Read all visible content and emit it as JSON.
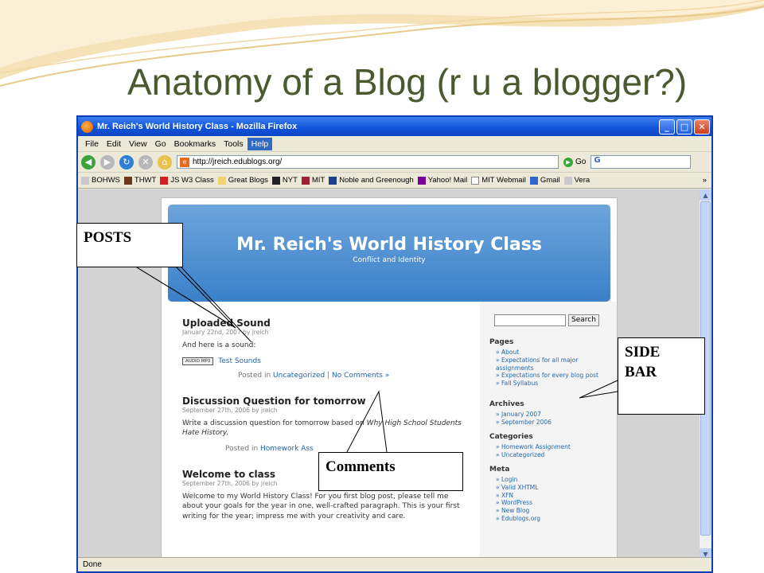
{
  "slide": {
    "title": "Anatomy of a Blog (r u a blogger?)"
  },
  "browser": {
    "window_title": "Mr. Reich's World History Class - Mozilla Firefox",
    "menu": [
      "File",
      "Edit",
      "View",
      "Go",
      "Bookmarks",
      "Tools",
      "Help"
    ],
    "url": "http://jreich.edublogs.org/",
    "go_label": "Go",
    "search_value": "G",
    "bookmarks": [
      "BOHWS",
      "THWT",
      "JS W3 Class",
      "Great Blogs",
      "NYT",
      "MIT",
      "Noble and Greenough",
      "Yahoo! Mail",
      "MIT Webmail",
      "Gmail",
      "Vera"
    ],
    "overflow": "»",
    "status": "Done"
  },
  "blog": {
    "title": "Mr. Reich's World History Class",
    "subtitle": "Conflict and Identity",
    "posts": [
      {
        "title": "Uploaded Sound",
        "meta": "January 22nd, 2007 by jreich",
        "body": "And here is a sound:",
        "audio_badge": "AUDIO MP3",
        "audio_link": "Test Sounds",
        "posted_in": "Posted in",
        "category": "Uncategorized",
        "sep": "|",
        "comments": "No Comments »"
      },
      {
        "title": "Discussion Question for tomorrow",
        "meta": "September 27th, 2006 by jreich",
        "body_pre": "Write a discussion question for tomorrow based on ",
        "body_em": "Why High School Students Hate History.",
        "posted_in": "Posted in",
        "category": "Homework Ass"
      },
      {
        "title": "Welcome to class",
        "meta": "September 27th, 2006 by jreich",
        "body": "Welcome to my World History Class! For you first blog post, please tell me about your goals for the year in one, well-crafted paragraph. This is your first writing for the year; impress me with your creativity and care."
      }
    ],
    "sidebar": {
      "search_button": "Search",
      "pages_heading": "Pages",
      "pages": [
        "» About",
        "» Expectations for all major assignments",
        "» Expectations for every blog post",
        "» Fall Syllabus"
      ],
      "archives_heading": "Archives",
      "archives": [
        "» January 2007",
        "» September 2006"
      ],
      "categories_heading": "Categories",
      "categories": [
        "» Homework Assignment",
        "» Uncategorized"
      ],
      "meta_heading": "Meta",
      "meta": [
        "» Login",
        "» Valid XHTML",
        "» XFN",
        "» WordPress",
        "» New Blog",
        "» Edublogs.org"
      ]
    }
  },
  "callouts": {
    "posts": "POSTS",
    "sidebar_line1": "SIDE",
    "sidebar_line2": "BAR",
    "comments": "Comments"
  },
  "colors": {
    "title": "#4a5a2e",
    "header_blue": "#3b80c9",
    "link": "#2367b0"
  }
}
